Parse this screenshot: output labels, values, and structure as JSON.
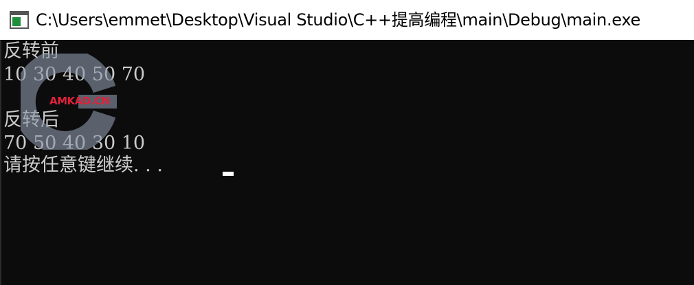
{
  "window": {
    "title": "C:\\Users\\emmet\\Desktop\\Visual Studio\\C++提高编程\\main\\Debug\\main.exe",
    "icon": "console-app-icon"
  },
  "console": {
    "lines": [
      "反转前",
      "10 30 40 50 70",
      "反转后",
      "70 50 40 30 10",
      "请按任意键继续. . . "
    ]
  },
  "watermark": {
    "text": "AMKAD.CN"
  },
  "colors": {
    "console_bg": "#0c0c0c",
    "console_text": "#cccccc",
    "titlebar_bg": "#ffffff",
    "watermark_accent": "#e0213a"
  }
}
